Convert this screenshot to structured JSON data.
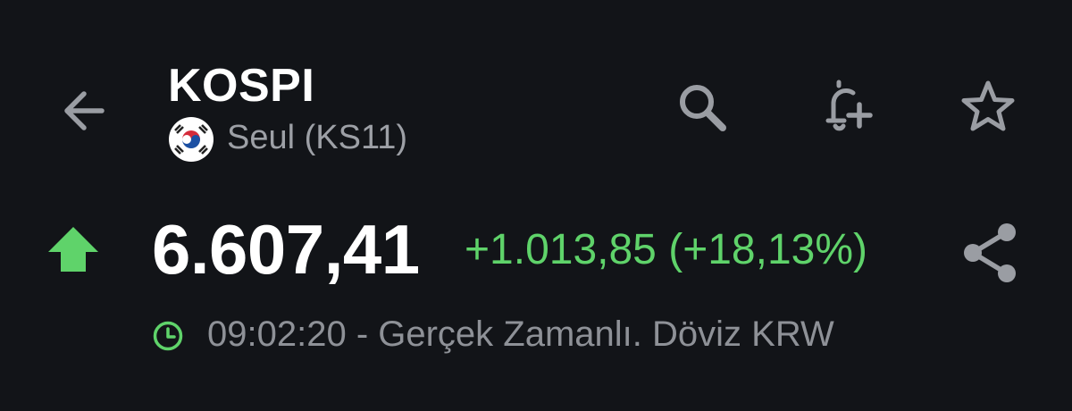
{
  "header": {
    "title": "KOSPI",
    "exchange_label": "Seul (KS11)",
    "icons": {
      "back": "arrow-left-icon",
      "search": "search-icon",
      "alert": "bell-plus-icon",
      "watchlist": "star-icon",
      "flag": "south-korea-flag-icon"
    }
  },
  "quote": {
    "price": "6.607,41",
    "change": "+1.013,85 (+18,13%)",
    "direction": "up",
    "direction_icon": "arrow-up-icon",
    "share_icon": "share-icon"
  },
  "status": {
    "clock_icon": "clock-icon",
    "text": "09:02:20 - Gerçek Zamanlı. Döviz KRW"
  },
  "colors": {
    "background": "#121418",
    "title": "#ffffff",
    "secondary_text": "#9da0a6",
    "positive": "#5fd36a",
    "icon": "#9a9da3"
  }
}
